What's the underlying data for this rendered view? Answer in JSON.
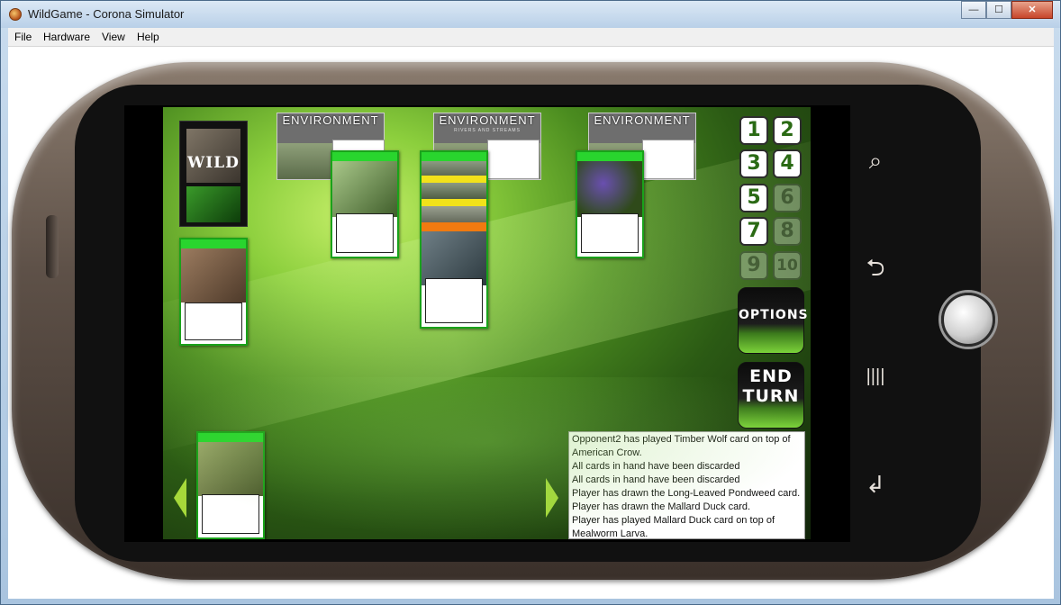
{
  "window": {
    "title": "WildGame - Corona Simulator",
    "min_label": "—",
    "max_label": "☐",
    "close_label": "✕"
  },
  "menu": {
    "file": "File",
    "hardware": "Hardware",
    "view": "View",
    "help": "Help"
  },
  "phone_buttons": {
    "search": "⌕",
    "back": "⮌",
    "menu": "||||",
    "return": "↲"
  },
  "deck": {
    "title": "WILD"
  },
  "environments": [
    {
      "title": "ENVIRONMENT"
    },
    {
      "title": "ENVIRONMENT",
      "subtitle": "RIVERS AND STREAMS"
    },
    {
      "title": "ENVIRONMENT"
    }
  ],
  "numbers": [
    {
      "label": "1",
      "enabled": true
    },
    {
      "label": "2",
      "enabled": true
    },
    {
      "label": "3",
      "enabled": true
    },
    {
      "label": "4",
      "enabled": true
    },
    {
      "label": "5",
      "enabled": true
    },
    {
      "label": "6",
      "enabled": false
    },
    {
      "label": "7",
      "enabled": true
    },
    {
      "label": "8",
      "enabled": false
    },
    {
      "label": "9",
      "enabled": false
    },
    {
      "label": "10",
      "enabled": false
    }
  ],
  "buttons": {
    "options": "OPTIONS",
    "end_line1": "END",
    "end_line2": "TURN"
  },
  "log": [
    "Opponent2 has played Timber Wolf card on top of American Crow.",
    "All cards in hand have been discarded",
    "All cards in hand have been discarded",
    "Player has drawn the Long-Leaved Pondweed card.",
    "Player has drawn the Mallard Duck card.",
    "Player has played Mallard Duck card on top of Mealworm Larva."
  ],
  "colors": {
    "card_green": "#29d52e",
    "accent_orange": "#f07a10",
    "accent_yellow": "#f2e21a",
    "arrow_green": "#a6d93a"
  }
}
